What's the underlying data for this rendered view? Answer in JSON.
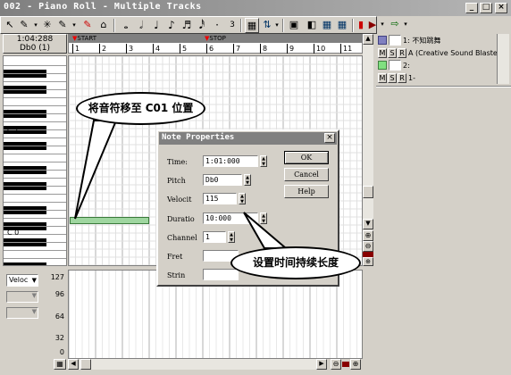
{
  "window": {
    "title": "002 - Piano Roll - Multiple Tracks",
    "minimize": "_",
    "maximize": "□",
    "close": "×"
  },
  "toolbar": {
    "tools": [
      "↖",
      "✎",
      "✳",
      "✎",
      "✎",
      "⌂"
    ],
    "notes": [
      "𝅝",
      "𝅗𝅥",
      "♩",
      "♪",
      "♬",
      "𝅘𝅥𝅰",
      "·",
      "3"
    ],
    "right_icons": [
      "▦",
      "⇅",
      "▣",
      "◧",
      "▦",
      "▦",
      "▮",
      "▶",
      "⇨"
    ]
  },
  "time": {
    "position": "1:04:288",
    "pitch": "Db0 (1)"
  },
  "ruler": {
    "start": "START",
    "stop": "STOP",
    "measures": [
      "1",
      "2",
      "3",
      "4",
      "5",
      "6",
      "7",
      "8",
      "9",
      "10",
      "11"
    ]
  },
  "keyboard": {
    "c1": "C 1",
    "c0": "C 0"
  },
  "velocity": {
    "select": "Veloc",
    "labels": [
      "127",
      "96",
      "64",
      "32",
      "0"
    ]
  },
  "tracks": [
    {
      "number": "1:",
      "name": "不知跳舞",
      "device": "A (Creative Sound Blaster F"
    },
    {
      "number": "2:",
      "name": "",
      "device": "1-"
    }
  ],
  "msr": [
    "M",
    "S",
    "R"
  ],
  "callouts": {
    "move": "将音符移至 C01 位置",
    "duration": "设置时间持续长度"
  },
  "dialog": {
    "title": "Note Properties",
    "fields": [
      {
        "label": "Time:",
        "value": "1:01:000"
      },
      {
        "label": "Pitch",
        "value": "Db0"
      },
      {
        "label": "Velocit",
        "value": "115"
      },
      {
        "label": "Duratio",
        "value": "10:000"
      },
      {
        "label": "Channel",
        "value": "1"
      },
      {
        "label": "Fret",
        "value": ""
      },
      {
        "label": "Strin",
        "value": ""
      }
    ],
    "buttons": {
      "ok": "OK",
      "cancel": "Cancel",
      "help": "Help"
    },
    "close": "×"
  }
}
